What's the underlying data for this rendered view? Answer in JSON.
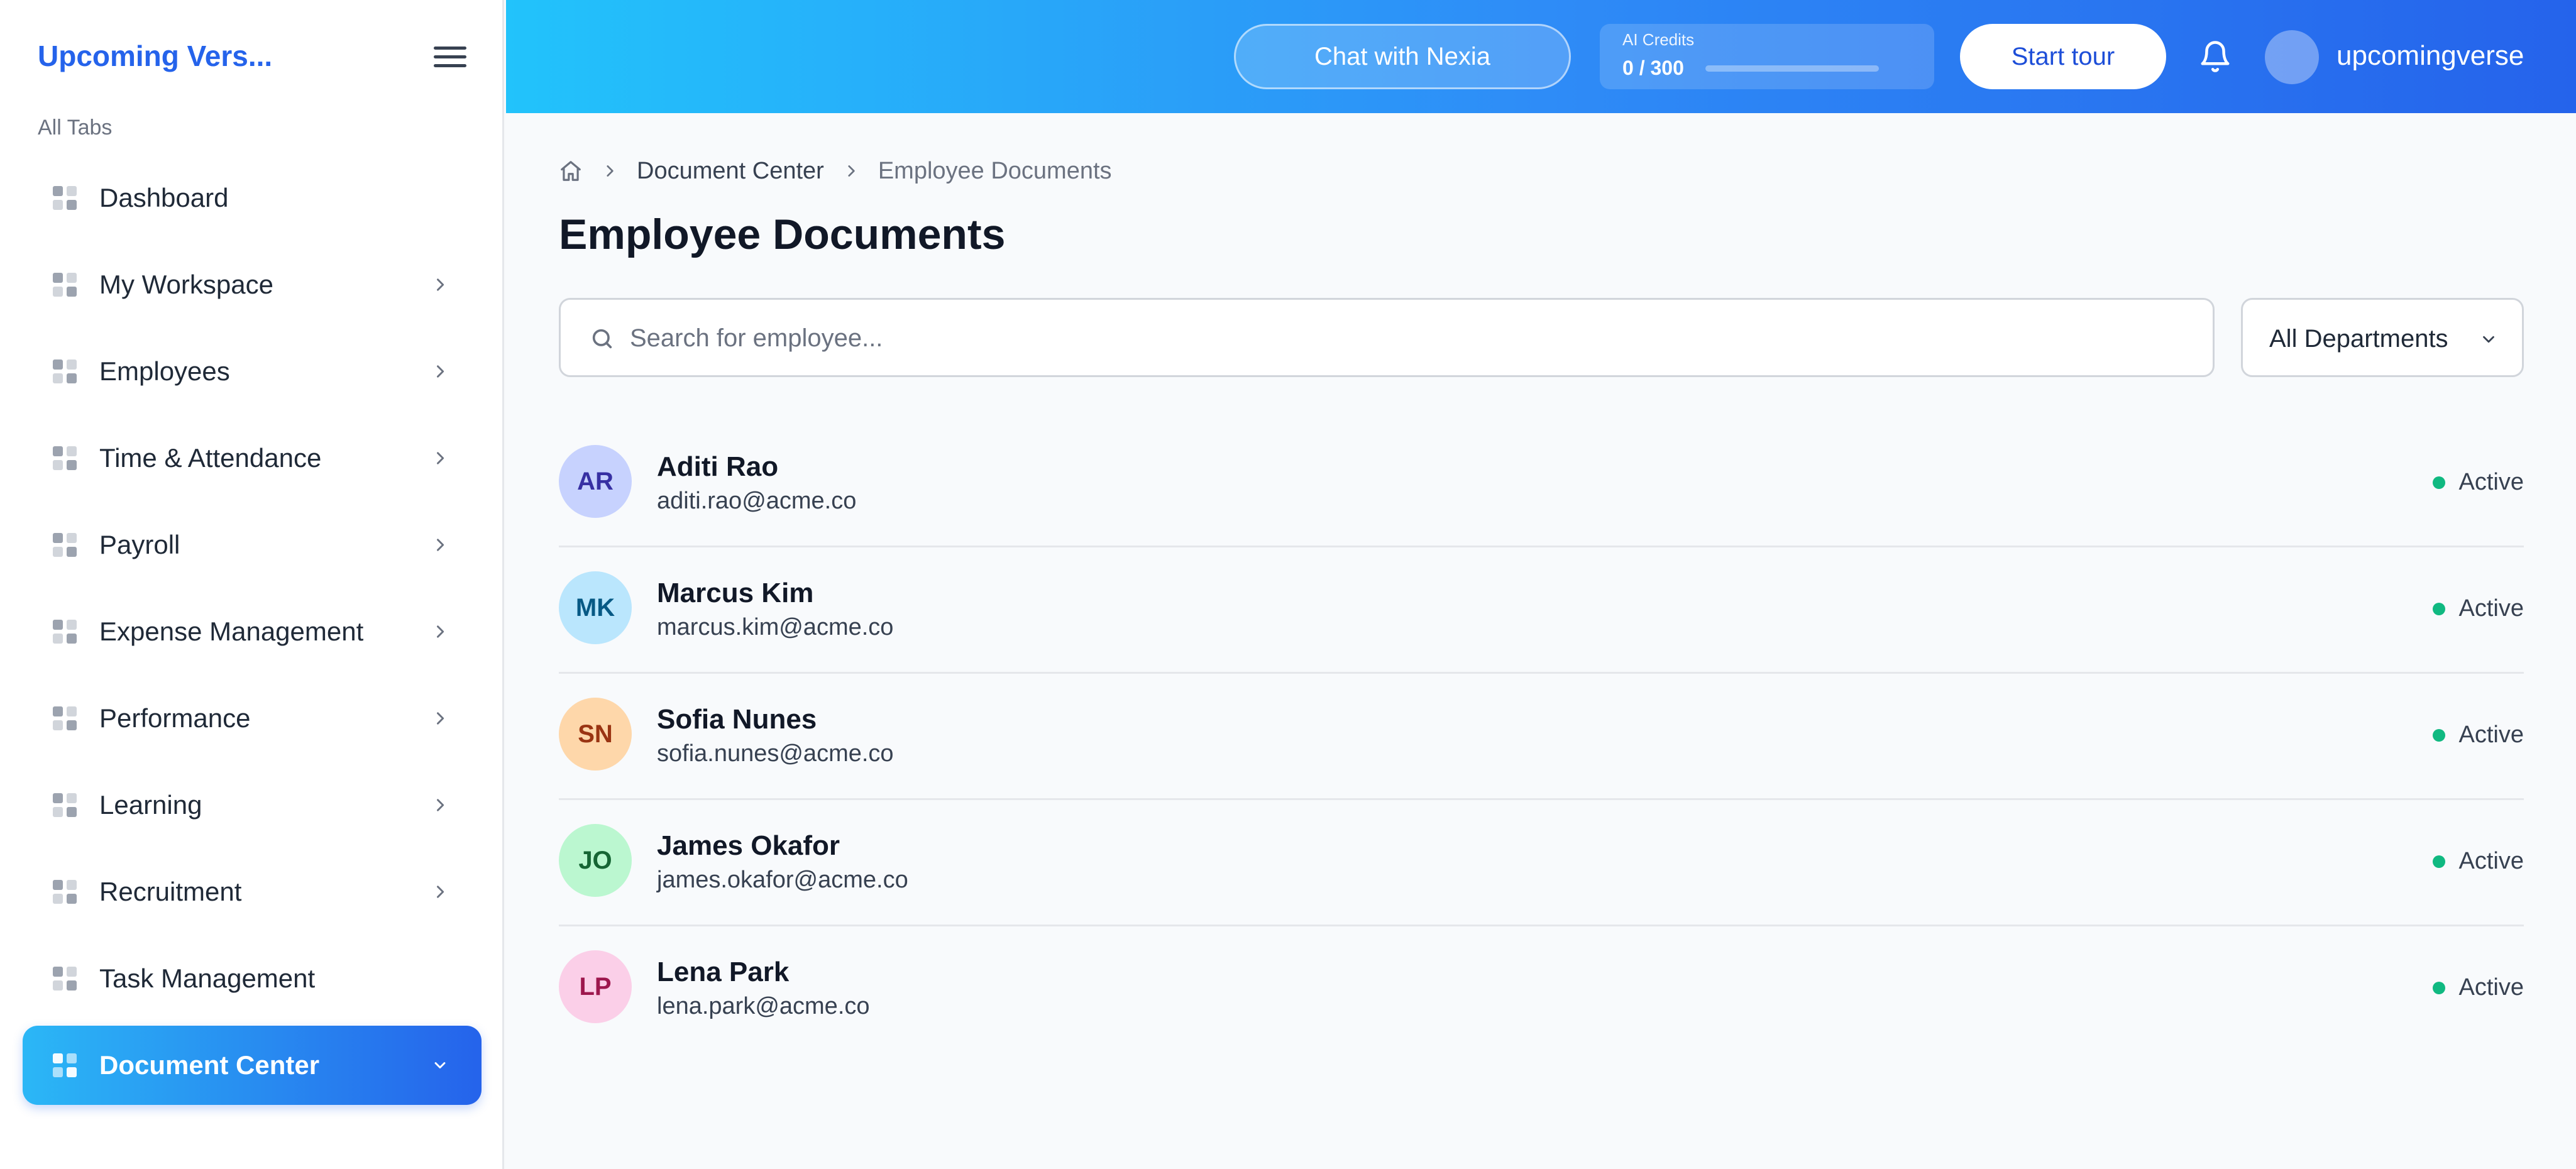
{
  "sidebar": {
    "brand": "Upcoming Vers...",
    "section_label": "All Tabs",
    "items": [
      {
        "label": "Dashboard",
        "has_chevron": false,
        "active": false
      },
      {
        "label": "My Workspace",
        "has_chevron": true,
        "active": false
      },
      {
        "label": "Employees",
        "has_chevron": true,
        "active": false
      },
      {
        "label": "Time & Attendance",
        "has_chevron": true,
        "active": false
      },
      {
        "label": "Payroll",
        "has_chevron": true,
        "active": false
      },
      {
        "label": "Expense Management",
        "has_chevron": true,
        "active": false
      },
      {
        "label": "Performance",
        "has_chevron": true,
        "active": false
      },
      {
        "label": "Learning",
        "has_chevron": true,
        "active": false
      },
      {
        "label": "Recruitment",
        "has_chevron": true,
        "active": false
      },
      {
        "label": "Task Management",
        "has_chevron": false,
        "active": false
      },
      {
        "label": "Document Center",
        "has_chevron": true,
        "active": true
      }
    ]
  },
  "header": {
    "chat_label": "Chat with Nexia",
    "credits_label": "AI Credits",
    "credits_value": "0 / 300",
    "credits_fraction": 0,
    "tour_label": "Start tour",
    "username": "upcomingverse"
  },
  "breadcrumb": {
    "parent": "Document Center",
    "current": "Employee Documents"
  },
  "page": {
    "title": "Employee Documents",
    "search_placeholder": "Search for employee...",
    "department_filter": "All Departments"
  },
  "employees": [
    {
      "initials": "AR",
      "name": "Aditi Rao",
      "email": "aditi.rao@acme.co",
      "status": "Active",
      "avatar_bg": "#c7d2fe",
      "avatar_fg": "#3730a3"
    },
    {
      "initials": "MK",
      "name": "Marcus Kim",
      "email": "marcus.kim@acme.co",
      "status": "Active",
      "avatar_bg": "#bae6fd",
      "avatar_fg": "#075985"
    },
    {
      "initials": "SN",
      "name": "Sofia Nunes",
      "email": "sofia.nunes@acme.co",
      "status": "Active",
      "avatar_bg": "#fed7aa",
      "avatar_fg": "#9a3412"
    },
    {
      "initials": "JO",
      "name": "James Okafor",
      "email": "james.okafor@acme.co",
      "status": "Active",
      "avatar_bg": "#bbf7d0",
      "avatar_fg": "#166534"
    },
    {
      "initials": "LP",
      "name": "Lena Park",
      "email": "lena.park@acme.co",
      "status": "Active",
      "avatar_bg": "#fbcfe8",
      "avatar_fg": "#9d174d"
    }
  ],
  "colors": {
    "accent": "#2563eb",
    "status_active": "#10b981"
  },
  "icons": {
    "menu": "hamburger-menu-icon",
    "nav": "grid-icon",
    "chevron": "chevron-right-icon",
    "bell": "bell-icon",
    "home": "home-icon",
    "search": "search-icon"
  }
}
